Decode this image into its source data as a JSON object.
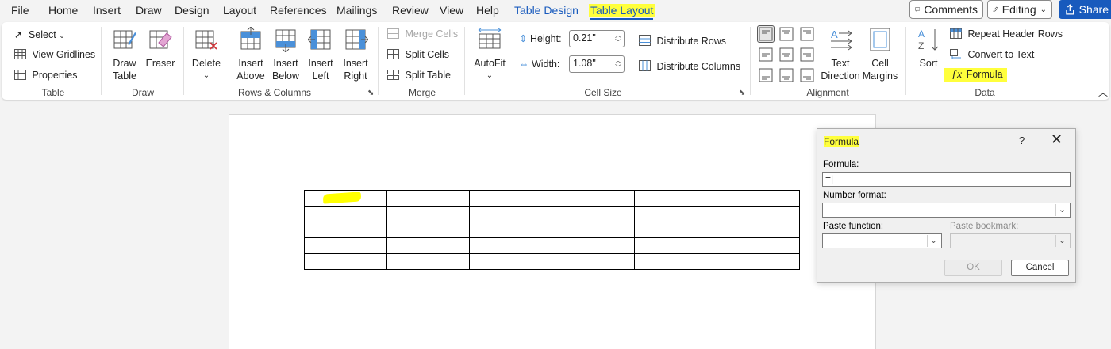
{
  "menu": {
    "tabs": [
      "File",
      "Home",
      "Insert",
      "Draw",
      "Design",
      "Layout",
      "References",
      "Mailings",
      "Review",
      "View",
      "Help",
      "Table Design",
      "Table Layout"
    ],
    "comments": "Comments",
    "editing": "Editing",
    "share": "Share"
  },
  "ribbon": {
    "table": {
      "select": "Select",
      "view_gridlines": "View Gridlines",
      "properties": "Properties",
      "label": "Table"
    },
    "draw": {
      "draw_table_1": "Draw",
      "draw_table_2": "Table",
      "eraser": "Eraser",
      "label": "Draw"
    },
    "rows_columns": {
      "delete": "Delete",
      "insert_above_1": "Insert",
      "insert_above_2": "Above",
      "insert_below_1": "Insert",
      "insert_below_2": "Below",
      "insert_left_1": "Insert",
      "insert_left_2": "Left",
      "insert_right_1": "Insert",
      "insert_right_2": "Right",
      "label": "Rows & Columns"
    },
    "merge": {
      "merge_cells": "Merge Cells",
      "split_cells": "Split Cells",
      "split_table": "Split Table",
      "label": "Merge"
    },
    "cell_size": {
      "autofit": "AutoFit",
      "height_label": "Height:",
      "height_value": "0.21\"",
      "width_label": "Width:",
      "width_value": "1.08\"",
      "distribute_rows": "Distribute Rows",
      "distribute_columns": "Distribute Columns",
      "label": "Cell Size"
    },
    "alignment": {
      "text_direction_1": "Text",
      "text_direction_2": "Direction",
      "cell_margins_1": "Cell",
      "cell_margins_2": "Margins",
      "label": "Alignment"
    },
    "data": {
      "sort": "Sort",
      "repeat_header_rows": "Repeat Header Rows",
      "convert_to_text": "Convert to Text",
      "formula": "Formula",
      "label": "Data"
    }
  },
  "dialog": {
    "title": "Formula",
    "help": "?",
    "formula_label": "Formula:",
    "formula_value": "=",
    "number_format_label": "Number format:",
    "paste_function_label": "Paste function:",
    "paste_bookmark_label": "Paste bookmark:",
    "ok": "OK",
    "cancel": "Cancel"
  },
  "colors": {
    "accent": "#185abd",
    "highlight": "#ffff3c",
    "ribbon_bg": "#ffffff",
    "app_bg": "#f3f3f3"
  }
}
